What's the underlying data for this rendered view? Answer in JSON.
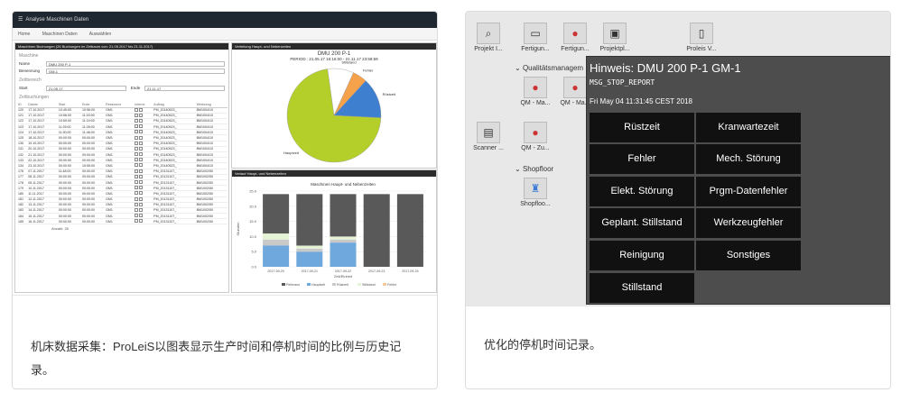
{
  "left_card": {
    "app_title": "Analyse Maschinen Daten",
    "breadcrumb": [
      "Home",
      "Maschinen Daten",
      "Auswählen"
    ],
    "list_pane_title": "Maschinen Buchungen (26 Buchungen im Zeitraum von: 21.05.2017 bis 21.11.2017)",
    "machine_section": "Maschine",
    "name_label": "Name",
    "name_value": "DMU 200 P-1",
    "bez_label": "Benennung",
    "bez_value": "GM-1",
    "period_section": "Zeitbereich",
    "start_label": "Start",
    "start_value": "21.05.17",
    "end_label": "Ende",
    "end_value": "21.11.17",
    "bookings_section": "Zeitbuchungen",
    "table_headers": [
      "ID",
      "Datum",
      "Start",
      "Ende",
      "Ressource",
      "Interne",
      "Auftrag",
      "Werkzeug"
    ],
    "table_rows": [
      [
        "120",
        "17.10.2017",
        "10:45:00",
        "10:56:00",
        "GM1",
        "PM_20140523_",
        "BM1004/10"
      ],
      [
        "121",
        "17.10.2017",
        "10:56:00",
        "11:03:00",
        "GM1",
        "PM_20140523_",
        "BM1004/10"
      ],
      [
        "122",
        "17.10.2017",
        "10:59:00",
        "11:24:00",
        "GM1",
        "PM_20140523_",
        "BM1004/10"
      ],
      [
        "123",
        "17.10.2017",
        "11:25:00",
        "11:26:00",
        "GM1",
        "PM_20140523_",
        "BM1004/10"
      ],
      [
        "124",
        "17.10.2017",
        "11:30:00",
        "11:46:00",
        "GM1",
        "PM_20140523_",
        "BM1004/10"
      ],
      [
        "125",
        "18.10.2017",
        "00:00:00",
        "00:00:00",
        "GM1",
        "PM_20140523_",
        "BM1004/10"
      ],
      [
        "130",
        "19.10.2017",
        "00:00:00",
        "00:00:00",
        "GM1",
        "PM_20140523_",
        "BM1004/10"
      ],
      [
        "131",
        "20.10.2017",
        "00:00:00",
        "00:00:00",
        "GM1",
        "PM_20140523_",
        "BM1004/10"
      ],
      [
        "132",
        "21.10.2017",
        "00:00:00",
        "00:00:00",
        "GM1",
        "PM_20140523_",
        "BM1004/10"
      ],
      [
        "133",
        "22.10.2017",
        "00:00:00",
        "00:00:00",
        "GM1",
        "PM_20140523_",
        "BM1004/10"
      ],
      [
        "134",
        "23.10.2017",
        "00:00:00",
        "15:55:00",
        "GM1",
        "PM_20140523_",
        "BM1004/10"
      ],
      [
        "176",
        "07.11.2017",
        "11:48:00",
        "00:00:00",
        "GM1",
        "PM_20131107_",
        "BM1002/50"
      ],
      [
        "177",
        "08.11.2017",
        "00:00:00",
        "00:00:00",
        "GM1",
        "PM_20131107_",
        "BM1002/50"
      ],
      [
        "178",
        "09.11.2017",
        "00:00:00",
        "00:00:00",
        "GM1",
        "PM_20131107_",
        "BM1002/50"
      ],
      [
        "179",
        "10.11.2017",
        "00:00:00",
        "00:00:00",
        "GM1",
        "PM_20131107_",
        "BM1002/50"
      ],
      [
        "180",
        "11.11.2017",
        "00:00:00",
        "00:00:00",
        "GM1",
        "PM_20131107_",
        "BM1002/50"
      ],
      [
        "181",
        "12.11.2017",
        "00:00:00",
        "00:00:00",
        "GM1",
        "PM_20131107_",
        "BM1002/50"
      ],
      [
        "182",
        "13.11.2017",
        "00:00:00",
        "00:00:00",
        "GM1",
        "PM_20131107_",
        "BM1002/50"
      ],
      [
        "183",
        "14.11.2017",
        "00:00:00",
        "00:00:00",
        "GM1",
        "PM_20131107_",
        "BM1002/50"
      ],
      [
        "184",
        "15.11.2017",
        "00:00:00",
        "00:00:00",
        "GM1",
        "PM_20131107_",
        "BM1002/50"
      ],
      [
        "185",
        "16.11.2017",
        "00:00:00",
        "00:00:00",
        "GM1",
        "PM_20131107_",
        "BM1002/50"
      ]
    ],
    "count_text": "Anzahl: 26",
    "pie_pane_title": "Verteilung Haupt- und Nebenzeiten",
    "pie_title": "DMU 200 P-1",
    "pie_period": "PERIOD : 21.05.17 16:16:00 - 21.11.17 23:59:59",
    "bar_pane_title": "Verlauf Haupt- und Nebenzeiten",
    "caption": "机床数据采集：ProLeiS以图表显示生产时间和停机时间的比例与历史记录。"
  },
  "chart_data": [
    {
      "type": "pie",
      "title": "DMU 200 P-1",
      "subtitle": "PERIOD : 21.05.17 16:16:00 - 21.11.17 23:59:59",
      "slices": [
        {
          "label": "Hauptzeit",
          "value": 72,
          "color": "#b5cf2a"
        },
        {
          "label": "Stillstand",
          "value": 9,
          "color": "#ffffff"
        },
        {
          "label": "Fehler",
          "value": 5,
          "color": "#f5a24a"
        },
        {
          "label": "Rüstzeit",
          "value": 14,
          "color": "#3f7fd0"
        }
      ]
    },
    {
      "type": "bar",
      "title": "Maschinen Haupt- und Nebenzeiten",
      "xlabel": "Zeit/Einheit",
      "ylabel": "Stunden",
      "ylim": [
        0,
        25
      ],
      "yticks": [
        "25.0",
        "20.0",
        "15.0",
        "10.0",
        "5.0",
        "0.0"
      ],
      "categories": [
        "2017-09-20",
        "2017-09-21",
        "2017-09-22",
        "2017-09-23",
        "2017-09-24"
      ],
      "series": [
        {
          "name": "Hauptzeit",
          "color": "#6fa8dc",
          "values": [
            7,
            5,
            8,
            0,
            0
          ]
        },
        {
          "name": "Rüstzeit",
          "color": "#c9c9c9",
          "values": [
            2,
            1,
            1,
            0,
            0
          ]
        },
        {
          "name": "Stillstand",
          "color": "#e6f2d6",
          "values": [
            2,
            1,
            1,
            0,
            0
          ]
        },
        {
          "name": "Pellerano",
          "color": "#595959",
          "values": [
            13,
            17,
            14,
            24,
            24
          ]
        }
      ],
      "legend": [
        "Pellerano",
        "Hauptzeit",
        "Rüstzeit",
        "Stillstand",
        "Fehler"
      ]
    }
  ],
  "right_card": {
    "tiles": [
      {
        "label": "Projekt I...",
        "icon": "search-icon"
      },
      {
        "label": "Fertigun...",
        "icon": "monitor-icon"
      },
      {
        "label": "Fertigun...",
        "icon": "lights-icon"
      },
      {
        "label": "Projektpl...",
        "icon": "screen-icon"
      },
      {
        "label": "Proleis V...",
        "icon": "phone-icon"
      },
      {
        "label": "QM - Ma...",
        "icon": "lights-icon"
      },
      {
        "label": "QM - Ma...",
        "icon": "lights-icon"
      },
      {
        "label": "Scanner ...",
        "icon": "scanner-icon"
      },
      {
        "label": "QM - Zu...",
        "icon": "lights-icon"
      },
      {
        "label": "Shopfloo...",
        "icon": "tower-icon"
      }
    ],
    "group_quality": "Qualitätsmanagem",
    "group_shopfloor": "Shopfloor",
    "popup_title": "Hinweis: DMU 200 P-1 GM-1",
    "popup_code": "MSG_STOP_REPORT",
    "popup_date": "Fri May 04 11:31:45 CEST 2018",
    "buttons": [
      "Rüstzeit",
      "Kranwartezeit",
      "Fehler",
      "Mech. Störung",
      "Elekt. Störung",
      "Prgm-Datenfehler",
      "Geplant. Stillstand",
      "Werkzeugfehler",
      "Reinigung",
      "Sonstiges",
      "Stillstand"
    ],
    "caption": "优化的停机时间记录。"
  }
}
